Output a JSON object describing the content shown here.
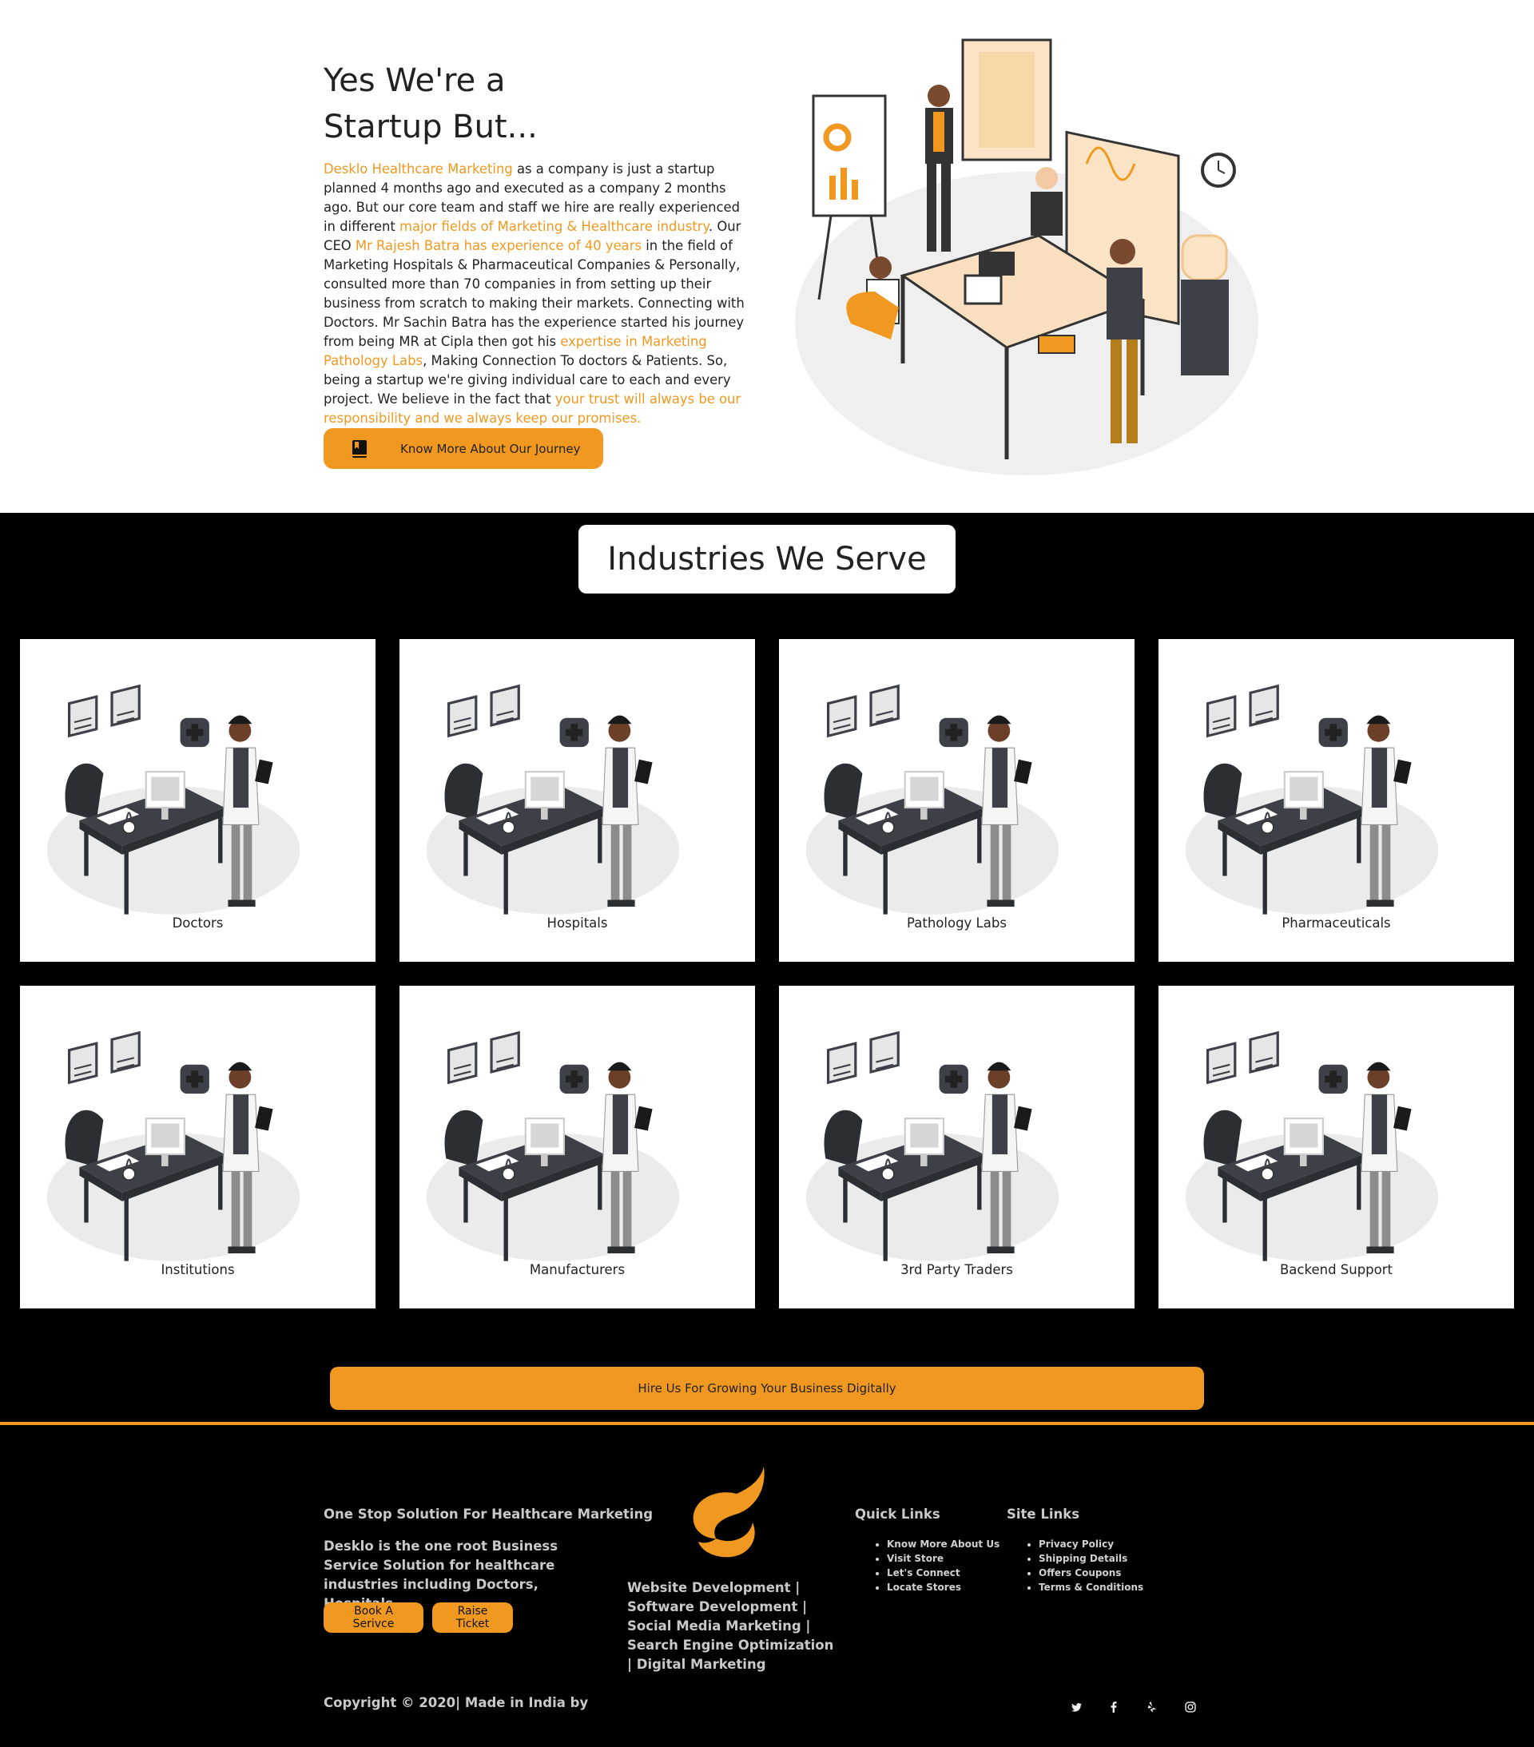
{
  "about": {
    "title": "Yes We're a Startup But...",
    "body": [
      {
        "t": "Desklo Healthcare Marketing",
        "hl": true
      },
      {
        "t": " as a company is just a startup planned 4 months ago and executed as a company 2 months ago. But our core team and staff we hire are really experienced in different ",
        "hl": false
      },
      {
        "t": "major fields of Marketing & Healthcare industry",
        "hl": true
      },
      {
        "t": ". Our CEO ",
        "hl": false
      },
      {
        "t": "Mr Rajesh Batra has experience of 40 years",
        "hl": true
      },
      {
        "t": " in the field of Marketing Hospitals & Pharmaceutical Companies & Personally, consulted more than 70 companies in from setting up their business from scratch to making their markets. Connecting with Doctors. Mr Sachin Batra has the experience started his journey from being MR at Cipla then got his ",
        "hl": false
      },
      {
        "t": "expertise in Marketing Pathology Labs",
        "hl": true
      },
      {
        "t": ", Making Connection To doctors & Patients. So, being a startup we're giving individual care to each and every project. We believe in the fact that ",
        "hl": false
      },
      {
        "t": "your trust will always be our responsibility and we always keep our promises.",
        "hl": true
      }
    ],
    "button_label": "Know More About Our Journey"
  },
  "industries": {
    "title": "Industries We Serve",
    "items": [
      "Doctors",
      "Hospitals",
      "Pathology Labs",
      "Pharmaceuticals",
      "Institutions",
      "Manufacturers",
      "3rd Party Traders",
      "Backend Support"
    ],
    "hire_label": "Hire Us For Growing Your Business Digitally"
  },
  "footer": {
    "tagline": "One Stop Solution For Healthcare Marketing",
    "description": "Desklo is the one root Business Service Solution for healthcare industries including Doctors, Hospitals,",
    "book_label": "Book A Serivce",
    "ticket_label": "Raise Ticket",
    "services": "Website Development | Software Development | Social Media Marketing | Search Engine Optimization | Digital Marketing",
    "quick_links": {
      "heading": "Quick Links",
      "items": [
        "Know More About Us",
        "Visit Store",
        "Let's Connect",
        "Locate Stores"
      ]
    },
    "site_links": {
      "heading": "Site Links",
      "items": [
        "Privacy Policy",
        "Shipping Details",
        "Offers Coupons",
        "Terms & Conditions"
      ]
    },
    "copyright": "Copyright © 2020| Made in India by",
    "social": [
      "twitter-icon",
      "facebook-icon",
      "yelp-icon",
      "instagram-icon"
    ]
  },
  "colors": {
    "accent": "#f0981f",
    "dark": "#000000",
    "text": "#222222"
  }
}
